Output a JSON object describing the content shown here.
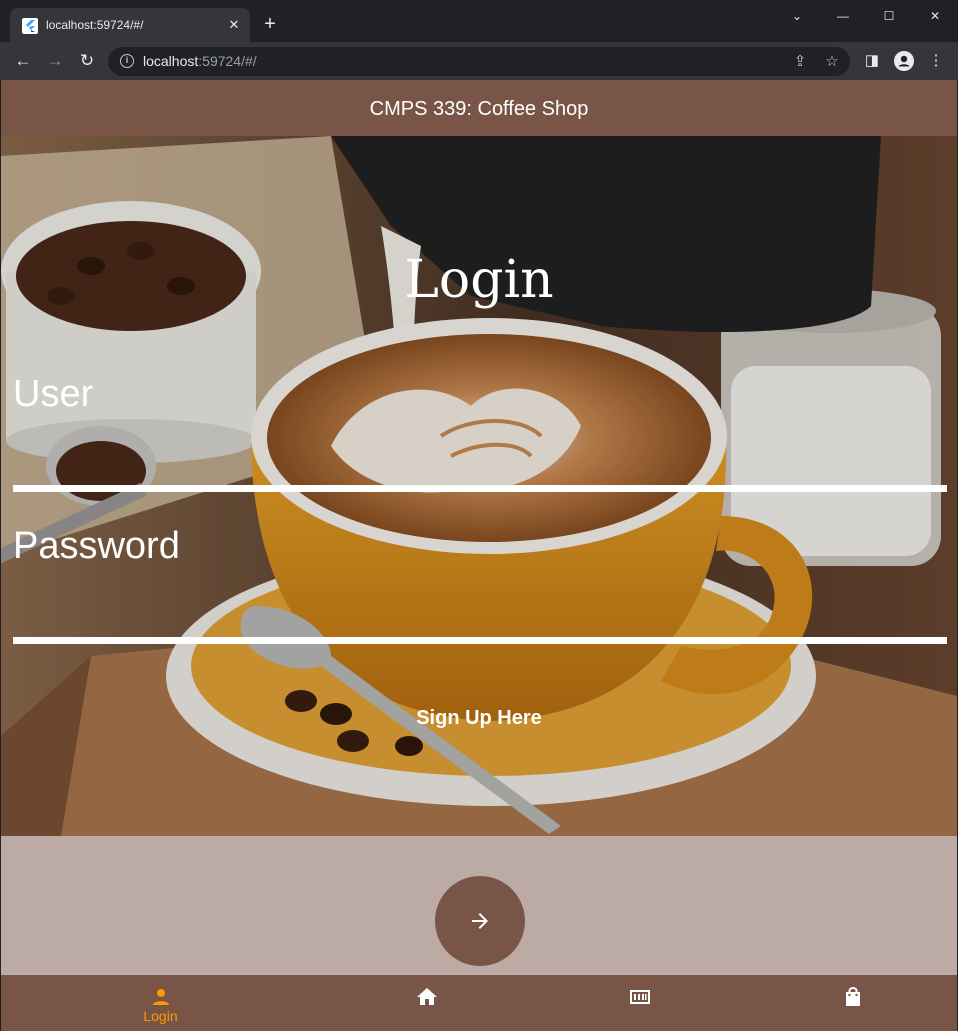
{
  "browser": {
    "tab_title": "localhost:59724/#/",
    "tab_close": "✕",
    "new_tab": "+",
    "url_host": "localhost",
    "url_rest": ":59724/#/",
    "window_controls": {
      "dropdown": "⌄",
      "minimize": "—",
      "maximize": "☐",
      "close": "✕"
    }
  },
  "app": {
    "title": "CMPS 339: Coffee Shop",
    "theme": {
      "primary": "#795548",
      "background": "#bcaaa4",
      "accent": "#ff9800",
      "text": "#ffffff"
    }
  },
  "login": {
    "heading": "Login",
    "user_label": "User",
    "user_value": "",
    "password_label": "Password",
    "password_value": "",
    "signup_link": "Sign Up Here",
    "submit_icon": "arrow-forward-icon"
  },
  "bottom_nav": {
    "items": [
      {
        "label": "Login",
        "icon": "person-icon",
        "active": true
      },
      {
        "label": "",
        "icon": "home-icon",
        "active": false
      },
      {
        "label": "",
        "icon": "ticket-icon",
        "active": false
      },
      {
        "label": "",
        "icon": "shopping-bag-icon",
        "active": false
      }
    ]
  }
}
